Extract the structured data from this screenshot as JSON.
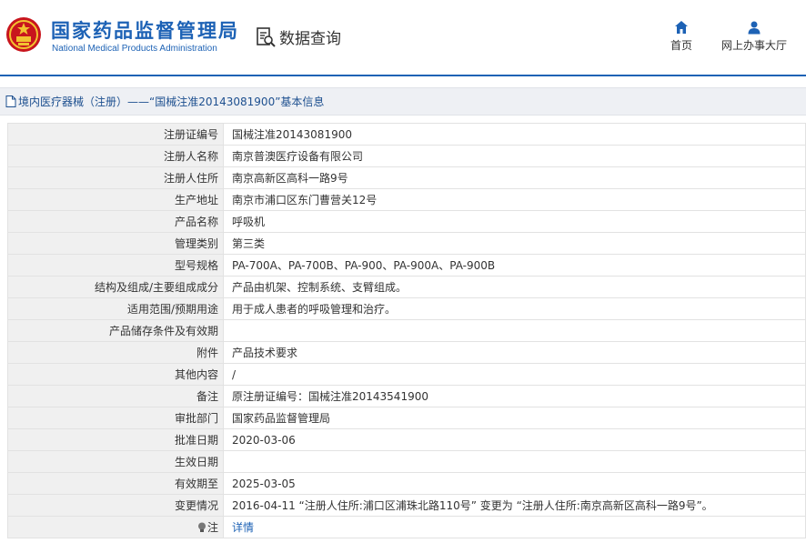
{
  "header": {
    "org_name_cn": "国家药品监督管理局",
    "org_name_en": "National Medical Products Administration",
    "query_label": "数据查询",
    "nav": [
      {
        "label": "首页",
        "icon": "home-icon"
      },
      {
        "label": "网上办事大厅",
        "icon": "user-icon"
      }
    ]
  },
  "breadcrumb": {
    "text": "境内医疗器械（注册）——“国械注准20143081900”基本信息"
  },
  "colors": {
    "brand_blue": "#1d62b5",
    "label_bg": "#f0f0f0",
    "breadcrumb_bg": "#eef0f4"
  },
  "rows": [
    {
      "label": "注册证编号",
      "value": "国械注准20143081900"
    },
    {
      "label": "注册人名称",
      "value": "南京普澳医疗设备有限公司"
    },
    {
      "label": "注册人住所",
      "value": "南京高新区高科一路9号"
    },
    {
      "label": "生产地址",
      "value": "南京市浦口区东门曹营关12号"
    },
    {
      "label": "产品名称",
      "value": "呼吸机"
    },
    {
      "label": "管理类别",
      "value": "第三类"
    },
    {
      "label": "型号规格",
      "value": "PA-700A、PA-700B、PA-900、PA-900A、PA-900B"
    },
    {
      "label": "结构及组成/主要组成成分",
      "value": "产品由机架、控制系统、支臂组成。"
    },
    {
      "label": "适用范围/预期用途",
      "value": "用于成人患者的呼吸管理和治疗。"
    },
    {
      "label": "产品储存条件及有效期",
      "value": ""
    },
    {
      "label": "附件",
      "value": "产品技术要求"
    },
    {
      "label": "其他内容",
      "value": "/"
    },
    {
      "label": "备注",
      "value": "原注册证编号：国械注准20143541900"
    },
    {
      "label": "审批部门",
      "value": "国家药品监督管理局"
    },
    {
      "label": "批准日期",
      "value": "2020-03-06"
    },
    {
      "label": "生效日期",
      "value": ""
    },
    {
      "label": "有效期至",
      "value": "2025-03-05"
    },
    {
      "label": "变更情况",
      "value": "2016-04-11 “注册人住所:浦口区浦珠北路110号” 变更为 “注册人住所:南京高新区高科一路9号”。"
    }
  ],
  "note_row": {
    "label": "注",
    "icon": "lightbulb-icon",
    "link": "详情"
  }
}
